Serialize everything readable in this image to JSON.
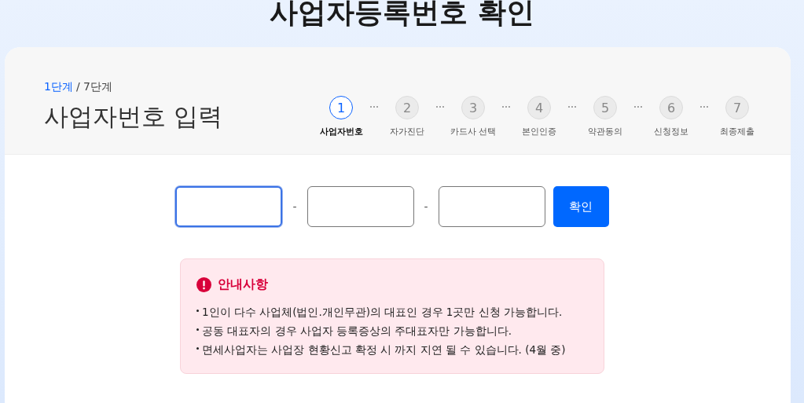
{
  "page_title": "사업자등록번호 확인",
  "header": {
    "step_current": "1단계",
    "step_total": "/ 7단계",
    "title": "사업자번호 입력"
  },
  "steps": [
    {
      "number": "1",
      "label": "사업자번호",
      "selected": true
    },
    {
      "number": "2",
      "label": "자가진단",
      "selected": false
    },
    {
      "number": "3",
      "label": "카드사 선택",
      "selected": false
    },
    {
      "number": "4",
      "label": "본인인증",
      "selected": false
    },
    {
      "number": "5",
      "label": "약관동의",
      "selected": false
    },
    {
      "number": "6",
      "label": "신청정보",
      "selected": false
    },
    {
      "number": "7",
      "label": "최종제출",
      "selected": false
    }
  ],
  "form": {
    "fields": [
      {
        "focused": true
      },
      {
        "focused": false
      },
      {
        "focused": false
      }
    ],
    "separators": [
      "-",
      "-"
    ],
    "button": "확인"
  },
  "notice": {
    "title": "안내사항",
    "items": [
      "1인이 다수 사업체(법인.개인무관)의 대표인 경우 1곳만 신청 가능합니다.",
      "공동 대표자의 경우 사업자 등록증상의 주대표자만 가능합니다.",
      "면세사업자는 사업장 현황신고 확정 시 까지 지연 될 수 있습니다. (4월 중)"
    ]
  }
}
